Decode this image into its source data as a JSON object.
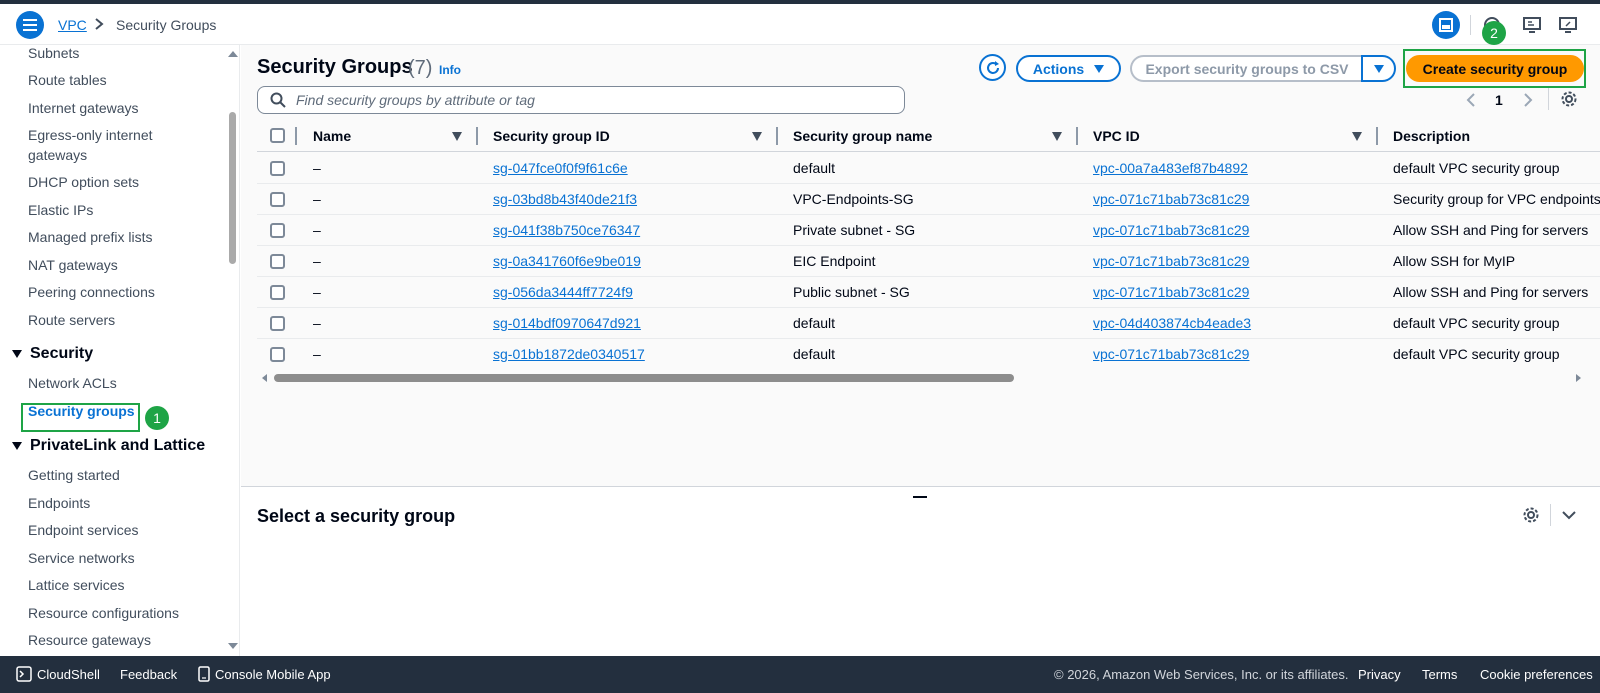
{
  "breadcrumb": {
    "service": "VPC",
    "current": "Security Groups"
  },
  "sidebar": {
    "items_top": [
      "Subnets",
      "Route tables",
      "Internet gateways",
      "Egress-only internet gateways",
      "DHCP option sets",
      "Elastic IPs",
      "Managed prefix lists",
      "NAT gateways",
      "Peering connections",
      "Route servers"
    ],
    "section_security": "Security",
    "security_items": [
      "Network ACLs",
      "Security groups"
    ],
    "section_privatelink": "PrivateLink and Lattice",
    "privatelink_items": [
      "Getting started",
      "Endpoints",
      "Endpoint services",
      "Service networks",
      "Lattice services",
      "Resource configurations",
      "Resource gateways"
    ]
  },
  "annotations": {
    "badge1": "1",
    "badge2": "2",
    "highlight_color": "#1ea446"
  },
  "header": {
    "title": "Security Groups",
    "count": "(7)",
    "info": "Info",
    "actions_label": "Actions",
    "export_label": "Export security groups to CSV",
    "create_label": "Create security group"
  },
  "search": {
    "placeholder": "Find security groups by attribute or tag",
    "value": ""
  },
  "pagination": {
    "page": "1"
  },
  "table": {
    "columns": [
      "Name",
      "Security group ID",
      "Security group name",
      "VPC ID",
      "Description"
    ],
    "rows": [
      {
        "name": "–",
        "id": "sg-047fce0f0f9f61c6e",
        "sg_name": "default",
        "vpc": "vpc-00a7a483ef87b4892",
        "desc": "default VPC security group"
      },
      {
        "name": "–",
        "id": "sg-03bd8b43f40de21f3",
        "sg_name": "VPC-Endpoints-SG",
        "vpc": "vpc-071c71bab73c81c29",
        "desc": "Security group for VPC endpoints"
      },
      {
        "name": "–",
        "id": "sg-041f38b750ce76347",
        "sg_name": "Private subnet - SG",
        "vpc": "vpc-071c71bab73c81c29",
        "desc": "Allow SSH and Ping for servers"
      },
      {
        "name": "–",
        "id": "sg-0a341760f6e9be019",
        "sg_name": "EIC Endpoint",
        "vpc": "vpc-071c71bab73c81c29",
        "desc": "Allow SSH for MyIP"
      },
      {
        "name": "–",
        "id": "sg-056da3444ff7724f9",
        "sg_name": "Public subnet - SG",
        "vpc": "vpc-071c71bab73c81c29",
        "desc": "Allow SSH and Ping for servers"
      },
      {
        "name": "–",
        "id": "sg-014bdf0970647d921",
        "sg_name": "default",
        "vpc": "vpc-04d403874cb4eade3",
        "desc": "default VPC security group"
      },
      {
        "name": "–",
        "id": "sg-01bb1872de0340517",
        "sg_name": "default",
        "vpc": "vpc-071c71bab73c81c29",
        "desc": "default VPC security group"
      }
    ]
  },
  "details_panel": {
    "title": "Select a security group"
  },
  "footer": {
    "cloudshell": "CloudShell",
    "feedback": "Feedback",
    "mobile": "Console Mobile App",
    "copyright": "© 2026, Amazon Web Services, Inc. or its affiliates.",
    "privacy": "Privacy",
    "terms": "Terms",
    "cookies": "Cookie preferences"
  },
  "colors": {
    "primary": "#0972d3",
    "cta": "#ff9900",
    "footer_bg": "#232f3e"
  }
}
